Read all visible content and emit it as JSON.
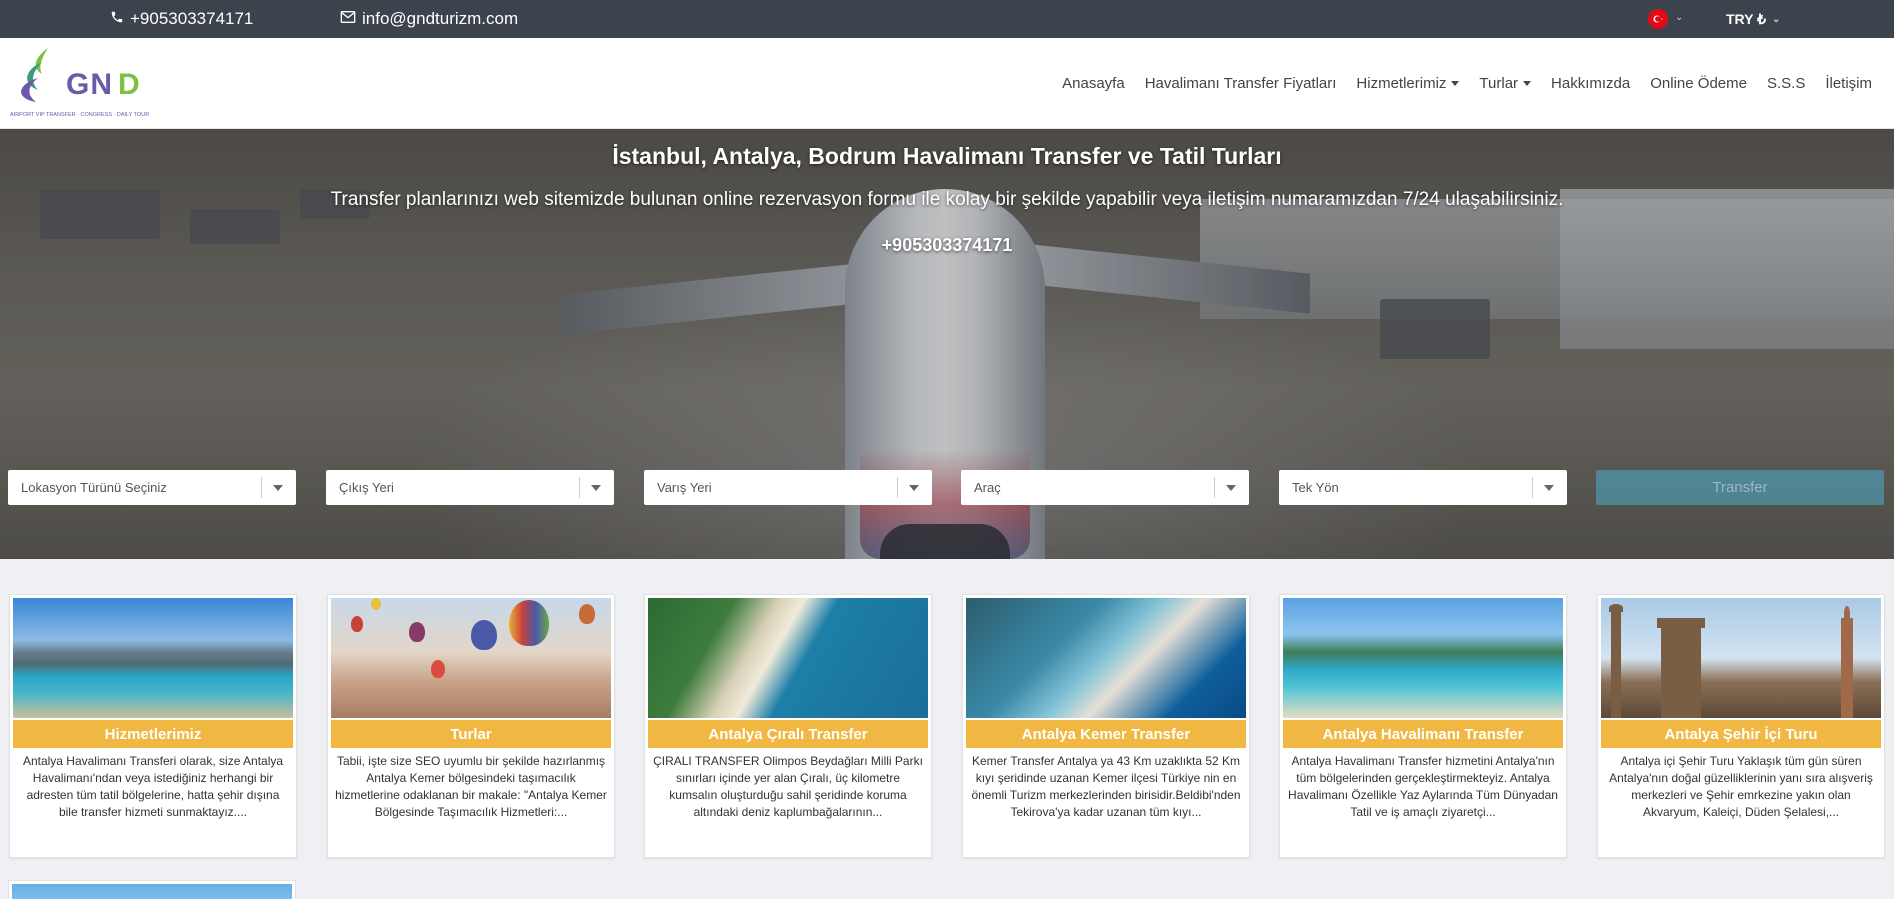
{
  "topbar": {
    "phone": "+905303374171",
    "email": "info@gndturizm.com",
    "currency": "TRY ₺"
  },
  "header": {
    "logo_text": "GND",
    "logo_tagline": "AIRPORT VIP TRANSFER · CONGRESS · DAILY TOUR",
    "nav": [
      {
        "label": "Anasayfa",
        "dropdown": false
      },
      {
        "label": "Havalimanı Transfer Fiyatları",
        "dropdown": false
      },
      {
        "label": "Hizmetlerimiz",
        "dropdown": true
      },
      {
        "label": "Turlar",
        "dropdown": true
      },
      {
        "label": "Hakkımızda",
        "dropdown": false
      },
      {
        "label": "Online Ödeme",
        "dropdown": false
      },
      {
        "label": "S.S.S",
        "dropdown": false
      },
      {
        "label": "İletişim",
        "dropdown": false
      }
    ]
  },
  "hero": {
    "title": "İstanbul, Antalya, Bodrum Havalimanı Transfer ve Tatil Turları",
    "subtitle": "Transfer planlarınızı web sitemizde bulunan online rezervasyon formu ile kolay bir şekilde yapabilir veya iletişim numaramızdan 7/24 ulaşabilirsiniz.",
    "phone": "+905303374171"
  },
  "search": {
    "location_type": "Lokasyon Türünü Seçiniz",
    "departure": "Çıkış Yeri",
    "arrival": "Varış Yeri",
    "vehicle": "Araç",
    "direction": "Tek Yön",
    "submit": "Transfer"
  },
  "cards": [
    {
      "title": "Hizmetlerimiz",
      "desc": "Antalya Havalimanı Transferi olarak, size Antalya Havalimanı'ndan veya istediğiniz herhangi bir adresten tüm tatil bölgelerine, hatta şehir dışına bile transfer hizmeti sunmaktayız...."
    },
    {
      "title": "Turlar",
      "desc": "Tabii, işte size SEO uyumlu bir şekilde hazırlanmış Antalya Kemer bölgesindeki taşımacılık hizmetlerine odaklanan bir makale: \"Antalya Kemer Bölgesinde Taşımacılık Hizmetleri:..."
    },
    {
      "title": "Antalya Çıralı Transfer",
      "desc": "ÇIRALI TRANSFER Olimpos Beydağları Milli Parkı sınırları içinde yer alan Çıralı, üç kilometre kumsalın oluşturduğu sahil şeridinde koruma altındaki deniz kaplumbağalarının..."
    },
    {
      "title": "Antalya Kemer Transfer",
      "desc": "Kemer Transfer Antalya ya 43 Km uzaklıkta 52 Km kıyı şeridinde uzanan Kemer ilçesi Türkiye nin en önemli Turizm merkezlerinden birisidir.Beldibi'nden Tekirova'ya kadar uzanan tüm kıyı..."
    },
    {
      "title": "Antalya Havalimanı Transfer",
      "desc": "Antalya Havalimanı Transfer hizmetini Antalya'nın tüm bölgelerinden gerçekleştirmekteyiz. Antalya Havalimanı Özellikle Yaz Aylarında Tüm Dünyadan Tatil ve iş amaçlı ziyaretçi..."
    },
    {
      "title": "Antalya Şehir İçi Turu",
      "desc": "Antalya içi Şehir Turu Yaklaşık tüm gün süren Antalya'nın doğal güzelliklerinin yanı sıra alışveriş merkezleri ve Şehir emrkezine yakın olan Akvaryum, Kaleiçi, Düden Şelalesi,..."
    }
  ],
  "colors": {
    "topbar_bg": "#3d434c",
    "card_title_bg": "#f0b742",
    "transfer_button": "#4d96aa",
    "logo_green": "#7cc242",
    "logo_purple": "#6b5aa8"
  }
}
